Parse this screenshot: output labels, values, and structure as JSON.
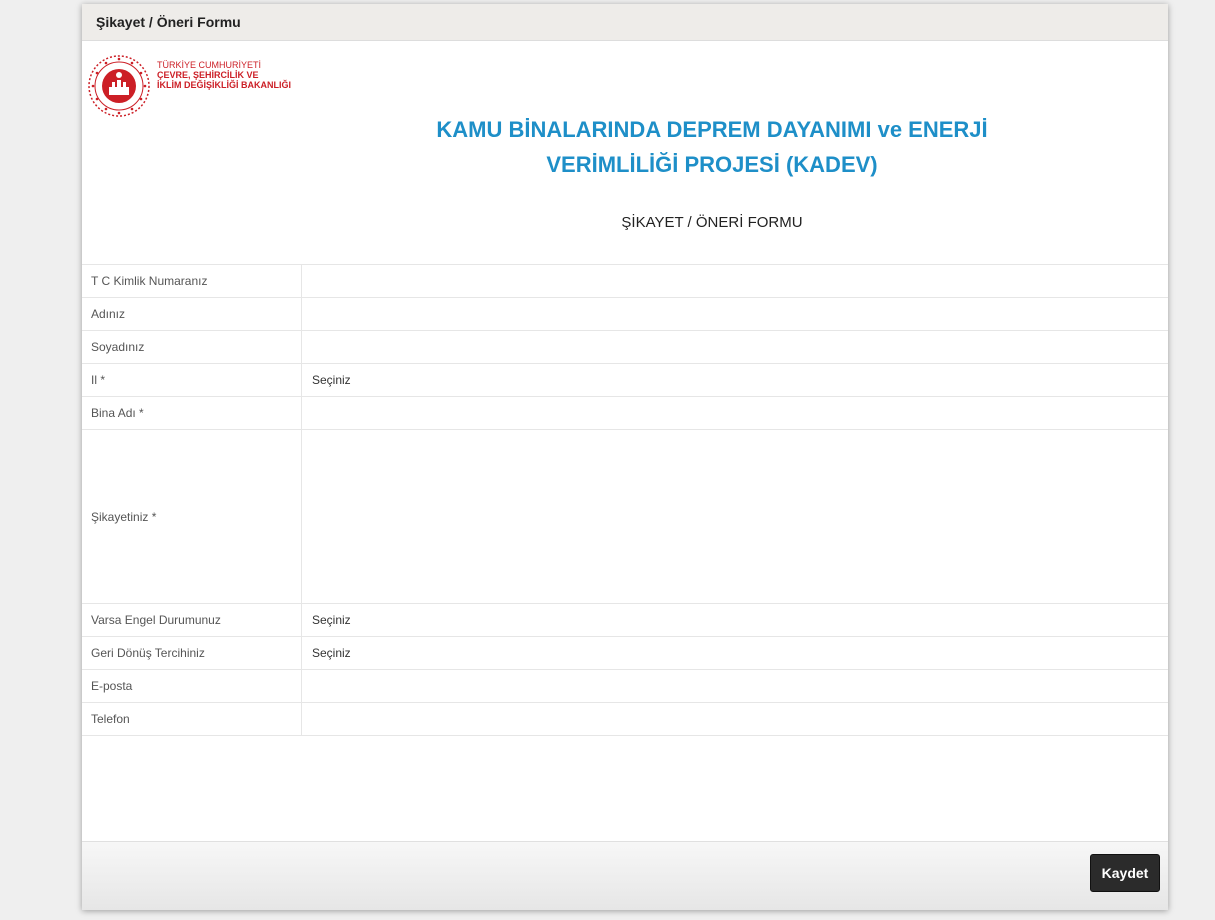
{
  "window": {
    "title": "Şikayet / Öneri Formu"
  },
  "logo": {
    "icon": "ministry-emblem-icon",
    "line1": "TÜRKİYE CUMHURİYETİ",
    "line2": "ÇEVRE, ŞEHİRCİLİK VE",
    "line3": "İKLİM DEĞİŞİKLİĞİ BAKANLIĞI",
    "brand_color": "#cc1f26"
  },
  "project": {
    "title_line1": "KAMU BİNALARINDA DEPREM DAYANIMI ve ENERJİ",
    "title_line2": "VERİMLİLİĞİ PROJESİ (KADEV)",
    "title_color": "#1e8fc8"
  },
  "form": {
    "heading": "ŞİKAYET / ÖNERİ FORMU",
    "fields": {
      "tc": {
        "label": "T C Kimlik Numaranız",
        "value": ""
      },
      "name": {
        "label": "Adınız",
        "value": ""
      },
      "surname": {
        "label": "Soyadınız",
        "value": ""
      },
      "city": {
        "label": "Il *",
        "value": "Seçiniz"
      },
      "building": {
        "label": "Bina Adı *",
        "value": ""
      },
      "complaint": {
        "label": "Şikayetiniz *",
        "value": ""
      },
      "disability": {
        "label": "Varsa Engel Durumunuz",
        "value": "Seçiniz"
      },
      "feedback_pref": {
        "label": "Geri Dönüş Tercihiniz",
        "value": "Seçiniz"
      },
      "email": {
        "label": "E-posta",
        "value": ""
      },
      "phone": {
        "label": "Telefon",
        "value": ""
      }
    }
  },
  "footer": {
    "save_label": "Kaydet"
  }
}
